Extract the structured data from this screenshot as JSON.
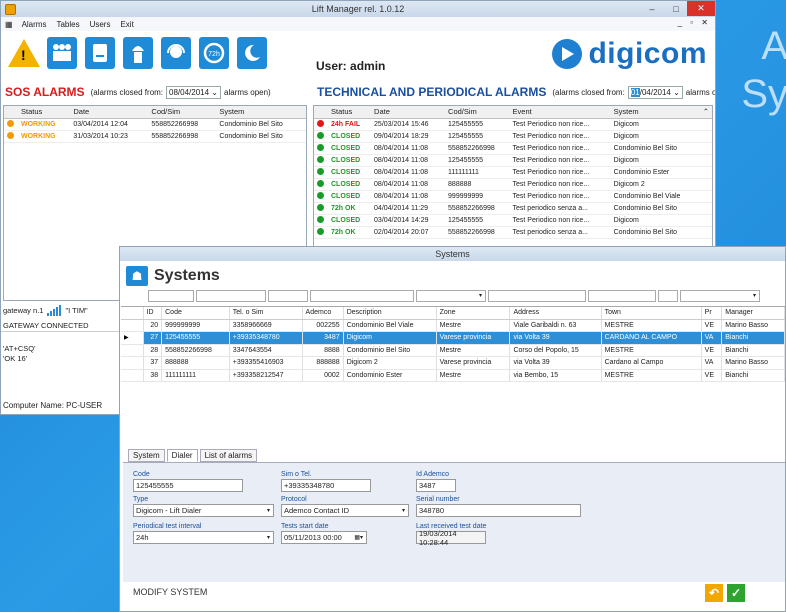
{
  "background_text": [
    "A",
    "Sy"
  ],
  "main": {
    "title": "Lift Manager rel. 1.0.12",
    "menu": [
      "Alarms",
      "Tables",
      "Users",
      "Exit"
    ],
    "toolbar_icons": [
      "alarm-warning-icon",
      "users-icon",
      "reports-icon",
      "technician-icon",
      "operator-headset-icon",
      "72h-cycle-icon",
      "night-mode-icon"
    ],
    "badge_72h": "72h",
    "user_label": "User: admin",
    "logo": "digicom",
    "sos": {
      "heading": "SOS ALARMS",
      "closed_prefix": "(alarms closed from:",
      "date": "08/04/2014",
      "closed_suffix": "alarms open)",
      "columns": [
        "Status",
        "Date",
        "Cod/Sim",
        "System"
      ],
      "rows": [
        {
          "status": "WORKING",
          "date": "03/04/2014 12:04",
          "cod": "558852266998",
          "system": "Condominio Bel Sito",
          "color": "#f39b00"
        },
        {
          "status": "WORKING",
          "date": "31/03/2014 10:23",
          "cod": "558852266998",
          "system": "Condominio Bel Sito",
          "color": "#f39b00"
        }
      ]
    },
    "tech": {
      "heading": "TECHNICAL AND PERIODICAL ALARMS",
      "closed_prefix": "(alarms closed from:",
      "date_sel": "01",
      "date_rest": "/04/2014",
      "closed_suffix": "alarms open)",
      "columns": [
        "Status",
        "Date",
        "Cod/Sim",
        "Event",
        "System"
      ],
      "rows": [
        {
          "status": "24h FAIL",
          "date": "25/03/2014 15:46",
          "cod": "125455555",
          "event": "Test Periodico non rice...",
          "system": "Digicom",
          "color": "#e01818"
        },
        {
          "status": "CLOSED",
          "date": "09/04/2014 18:29",
          "cod": "125455555",
          "event": "Test Periodico non rice...",
          "system": "Digicom",
          "color": "#1a9a2a"
        },
        {
          "status": "CLOSED",
          "date": "08/04/2014 11:08",
          "cod": "558852266998",
          "event": "Test Periodico non rice...",
          "system": "Condominio Bel Sito",
          "color": "#1a9a2a"
        },
        {
          "status": "CLOSED",
          "date": "08/04/2014 11:08",
          "cod": "125455555",
          "event": "Test Periodico non rice...",
          "system": "Digicom",
          "color": "#1a9a2a"
        },
        {
          "status": "CLOSED",
          "date": "08/04/2014 11:08",
          "cod": "111111111",
          "event": "Test Periodico non rice...",
          "system": "Condominio Ester",
          "color": "#1a9a2a"
        },
        {
          "status": "CLOSED",
          "date": "08/04/2014 11:08",
          "cod": "888888",
          "event": "Test Periodico non rice...",
          "system": "Digicom 2",
          "color": "#1a9a2a"
        },
        {
          "status": "CLOSED",
          "date": "08/04/2014 11:08",
          "cod": "999999999",
          "event": "Test Periodico non rice...",
          "system": "Condominio Bel Viale",
          "color": "#1a9a2a"
        },
        {
          "status": "72h OK",
          "date": "04/04/2014 11:29",
          "cod": "558852266998",
          "event": "Test periodico senza a...",
          "system": "Condominio Bel Sito",
          "color": "#1a9a2a"
        },
        {
          "status": "CLOSED",
          "date": "03/04/2014 14:29",
          "cod": "125455555",
          "event": "Test Periodico non rice...",
          "system": "Digicom",
          "color": "#1a9a2a"
        },
        {
          "status": "72h OK",
          "date": "02/04/2014 20:07",
          "cod": "558852266998",
          "event": "Test periodico senza a...",
          "system": "Condominio Bel Sito",
          "color": "#1a9a2a"
        }
      ]
    },
    "gateway": {
      "label": "gateway n.1",
      "carrier": "\"I TIM\"",
      "connected": "GATEWAY CONNECTED",
      "cmd1": "'AT+CSQ'",
      "cmd2": "'OK 16'"
    },
    "computer_name": "Computer Name: PC-USER"
  },
  "systems": {
    "window_title": "Systems",
    "heading": "Systems",
    "columns": [
      "ID",
      "Code",
      "Tel. o Sim",
      "Ademco",
      "Description",
      "Zone",
      "Address",
      "Town",
      "Pr",
      "Manager"
    ],
    "rows": [
      [
        "20",
        "999999999",
        "3358966669",
        "002255",
        "Condominio Bel Viale",
        "Mestre",
        "Viale Garibaldi n. 63",
        "MESTRE",
        "VE",
        "Marino Basso"
      ],
      [
        "27",
        "125455555",
        "+39335348780",
        "3487",
        "Digicom",
        "Varese provincia",
        "via Volta 39",
        "CARDANO AL CAMPO",
        "VA",
        "Bianchi"
      ],
      [
        "28",
        "558852266998",
        "3347643554",
        "8888",
        "Condominio Bel Sito",
        "Mestre",
        "Corso del Popolo, 15",
        "MESTRE",
        "VE",
        "Bianchi"
      ],
      [
        "37",
        "888888",
        "+393355416903",
        "888888",
        "Digicom 2",
        "Varese provincia",
        "via Volta 39",
        "Cardano al Campo",
        "VA",
        "Marino Basso"
      ],
      [
        "38",
        "111111111",
        "+393358212547",
        "0002",
        "Condominio Ester",
        "Mestre",
        "via Bembo, 15",
        "MESTRE",
        "VE",
        "Bianchi"
      ]
    ],
    "selected_index": 1,
    "tabs": [
      "System",
      "Dialer",
      "List of alarms"
    ],
    "active_tab": 1,
    "form": {
      "code_label": "Code",
      "code": "125455555",
      "sim_label": "Sim o Tel.",
      "sim": "+39335348780",
      "ademco_label": "Id Ademco",
      "ademco": "3487",
      "type_label": "Type",
      "type": "Digicom - Lift Dialer",
      "protocol_label": "Protocol",
      "protocol": "Ademco Contact ID",
      "serial_label": "Serial number",
      "serial": "348780",
      "interval_label": "Periodical test interval",
      "interval": "24h",
      "start_label": "Tests start date",
      "start": "05/11/2013 00:00",
      "last_label": "Last received test date",
      "last": "19/03/2014 10:28:44"
    },
    "footer": "MODIFY SYSTEM"
  },
  "colors": {
    "accent": "#1f8ad6",
    "sos_red": "#d61d1d",
    "tech_blue": "#1a4f9e",
    "selected_row": "#2e8fd6"
  }
}
